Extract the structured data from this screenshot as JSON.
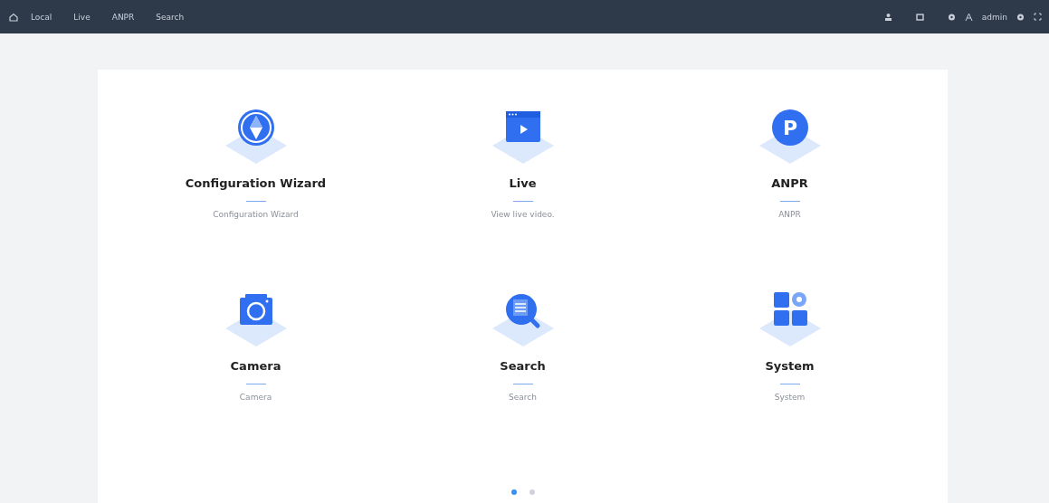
{
  "nav": {
    "items": [
      {
        "label": "Local",
        "selected": false
      },
      {
        "label": "Live",
        "selected": false
      },
      {
        "label": "ANPR",
        "selected": false
      },
      {
        "label": "Search",
        "selected": false
      }
    ],
    "user": "admin"
  },
  "tiles": [
    {
      "kind": "compass",
      "title": "Configuration Wizard",
      "description": "Configuration Wizard"
    },
    {
      "kind": "video",
      "title": "Live",
      "description": "View live video."
    },
    {
      "kind": "badge",
      "badge": "P",
      "title": "ANPR",
      "description": "ANPR"
    },
    {
      "kind": "camera",
      "title": "Camera",
      "description": "Camera"
    },
    {
      "kind": "search",
      "title": "Search",
      "description": "Search"
    },
    {
      "kind": "system",
      "title": "System",
      "description": "System"
    }
  ],
  "pages": [
    {
      "selected": true
    },
    {
      "selected": false
    }
  ]
}
